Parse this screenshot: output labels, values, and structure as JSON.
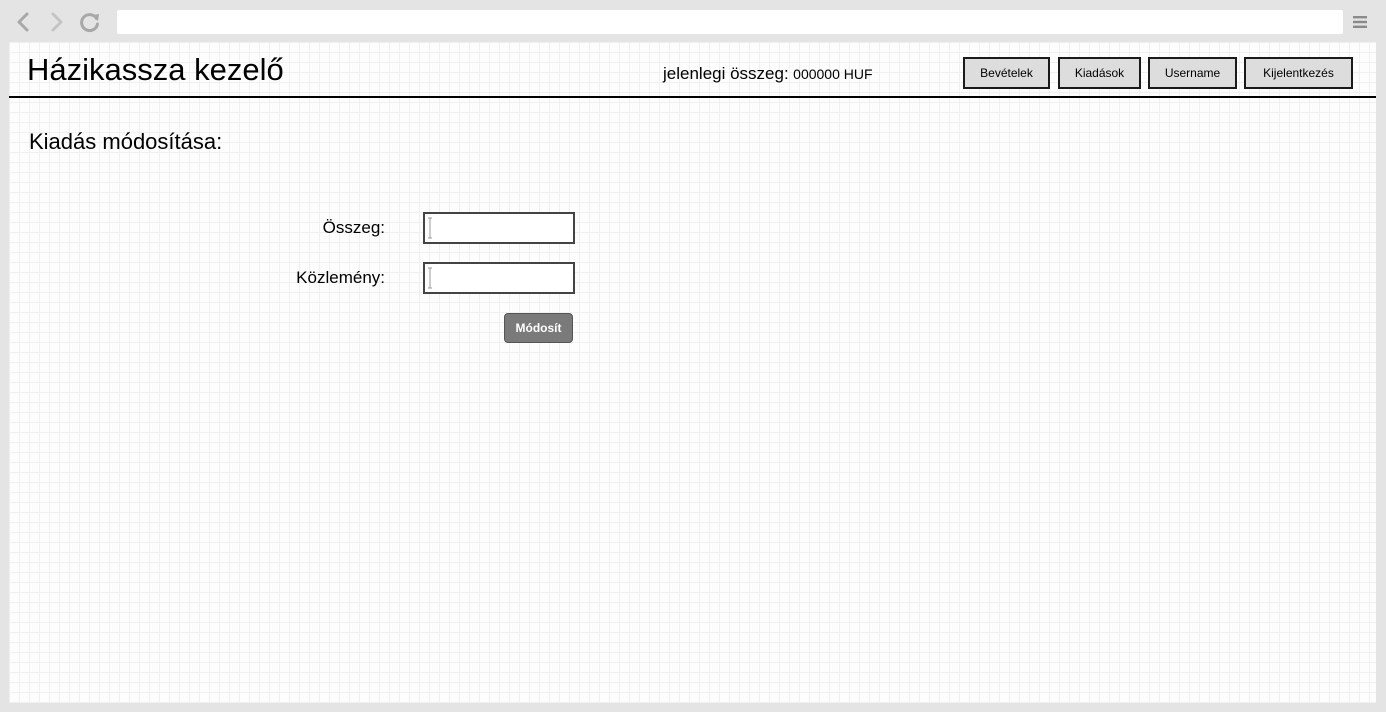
{
  "browser": {
    "address_bar_value": "",
    "icons": {
      "back": "chevron-left-icon",
      "forward": "chevron-right-icon",
      "reload": "reload-icon",
      "menu": "hamburger-menu-icon"
    }
  },
  "header": {
    "app_title": "Házikassza kezelő",
    "balance_label": "jelenlegi összeg:",
    "balance_value": "000000 HUF",
    "nav": {
      "income": "Bevételek",
      "expense": "Kiadások",
      "user": "Username",
      "logout": "Kijelentkezés"
    }
  },
  "main": {
    "heading": "Kiadás módosítása:",
    "form": {
      "amount_label": "Összeg:",
      "amount_value": "",
      "note_label": "Közlemény:",
      "note_value": "",
      "submit_label": "Módosít"
    }
  },
  "colors": {
    "page_background": "#fdfdfd",
    "grid_line": "#f0f0f0",
    "nav_button_bg": "#dddddd",
    "submit_button_bg": "#7a7a7a",
    "browser_chrome": "#e4e4e4"
  }
}
